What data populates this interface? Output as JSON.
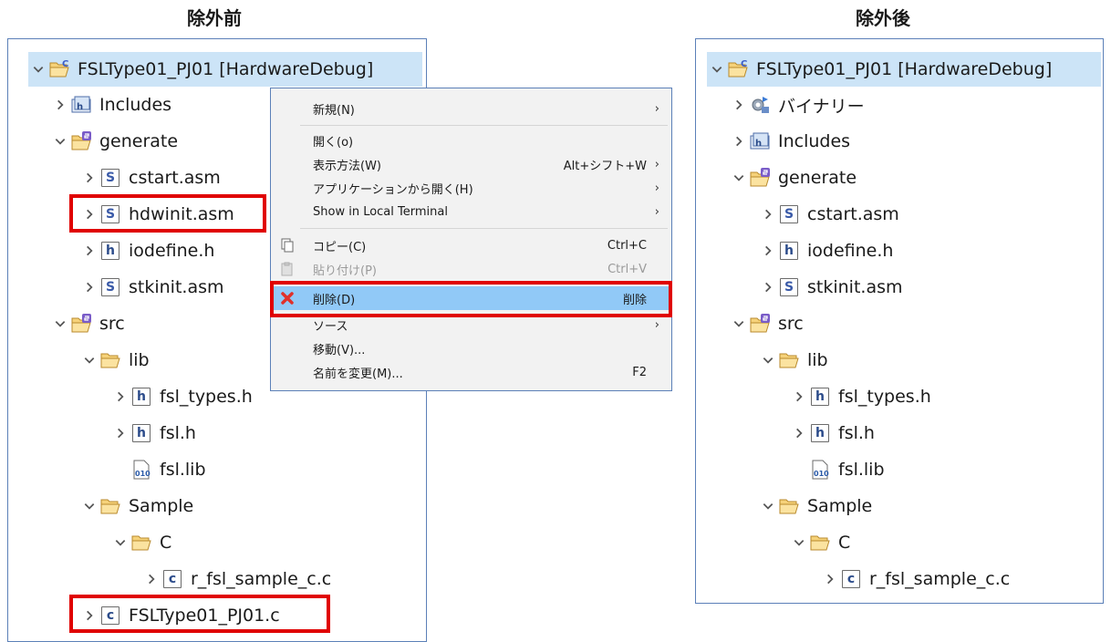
{
  "headings": {
    "before": "除外前",
    "after": "除外後"
  },
  "left_tree": {
    "project": "FSLType01_PJ01 [HardwareDebug]",
    "includes": "Includes",
    "generate": "generate",
    "cstart": "cstart.asm",
    "hdwinit": "hdwinit.asm",
    "iodefine": "iodefine.h",
    "stkinit": "stkinit.asm",
    "src": "src",
    "lib": "lib",
    "fsl_types": "fsl_types.h",
    "fsl_h": "fsl.h",
    "fsl_lib": "fsl.lib",
    "sample": "Sample",
    "c_folder": "C",
    "sample_c": "r_fsl_sample_c.c",
    "main_c": "FSLType01_PJ01.c"
  },
  "context_menu": {
    "new": "新規(N)",
    "open": "開く(o)",
    "open_with": "表示方法(W)",
    "open_with_shortcut": "Alt+シフト+W",
    "open_app": "アプリケーションから開く(H)",
    "local_terminal": "Show in Local Terminal",
    "copy": "コピー(C)",
    "copy_shortcut": "Ctrl+C",
    "paste": "貼り付け(P)",
    "paste_shortcut": "Ctrl+V",
    "delete": "削除(D)",
    "delete_shortcut": "削除",
    "source": "ソース",
    "move": "移動(V)...",
    "rename": "名前を変更(M)...",
    "rename_shortcut": "F2"
  },
  "right_tree": {
    "project": "FSLType01_PJ01 [HardwareDebug]",
    "binaries": "バイナリー",
    "includes": "Includes",
    "generate": "generate",
    "cstart": "cstart.asm",
    "iodefine": "iodefine.h",
    "stkinit": "stkinit.asm",
    "src": "src",
    "lib": "lib",
    "fsl_types": "fsl_types.h",
    "fsl_h": "fsl.h",
    "fsl_lib": "fsl.lib",
    "sample": "Sample",
    "c_folder": "C",
    "sample_c": "r_fsl_sample_c.c"
  },
  "colors": {
    "selection": "#cce4f7",
    "menu_highlight": "#91c9f7",
    "red_box": "#e00000",
    "panel_border": "#5b80b8"
  }
}
